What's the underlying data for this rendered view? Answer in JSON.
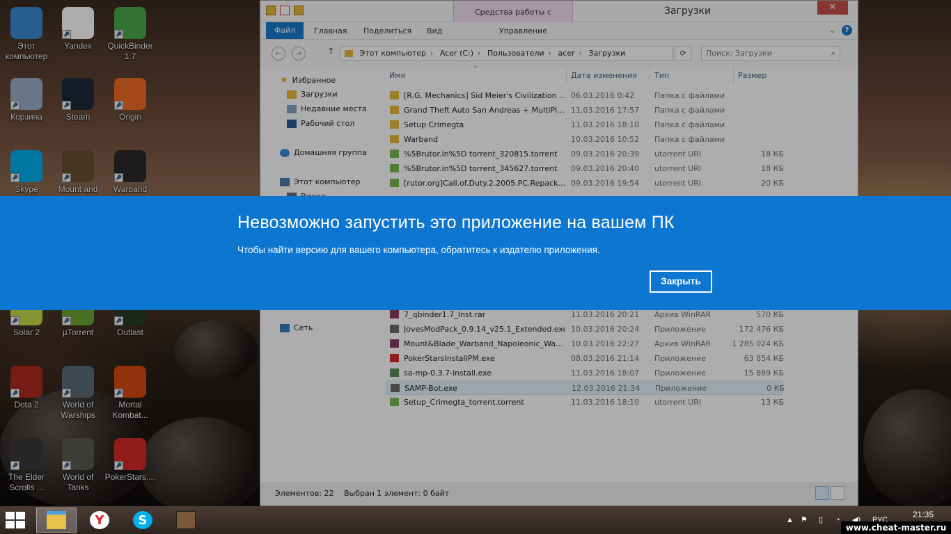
{
  "desktop": {
    "icons": [
      {
        "label": "Этот компьютер",
        "icon": "computer-icon",
        "color": "#3b8ad8"
      },
      {
        "label": "Yandex",
        "icon": "yandex-icon",
        "color": "#ffffff"
      },
      {
        "label": "QuickBinder 1.7",
        "icon": "quickbinder-icon",
        "color": "#4aa84a"
      },
      {
        "label": "Корзина",
        "icon": "recycle-bin-icon",
        "color": "#9ab0c8"
      },
      {
        "label": "Steam",
        "icon": "steam-icon",
        "color": "#1b2838"
      },
      {
        "label": "Origin",
        "icon": "origin-icon",
        "color": "#f06c22"
      },
      {
        "label": "Skype",
        "icon": "skype-icon",
        "color": "#00aff0"
      },
      {
        "label": "Mount and",
        "icon": "mount-and-blade-icon",
        "color": "#6b4e32"
      },
      {
        "label": "Warband",
        "icon": "warband-icon",
        "color": "#2a2a2a"
      },
      {
        "label": "Solar 2",
        "icon": "solar2-icon",
        "color": "#c8d84a"
      },
      {
        "label": "µTorrent",
        "icon": "utorrent-icon",
        "color": "#6aa832"
      },
      {
        "label": "Outlast",
        "icon": "outlast-icon",
        "color": "#2a3a2a"
      },
      {
        "label": "Dota 2",
        "icon": "dota2-icon",
        "color": "#b02a1e"
      },
      {
        "label": "World of Warships",
        "icon": "world-of-warships-icon",
        "color": "#5a6a78"
      },
      {
        "label": "Mortal Kombat...",
        "icon": "mortal-kombat-icon",
        "color": "#d84a12"
      },
      {
        "label": "The Elder Scrolls ...",
        "icon": "elder-scrolls-icon",
        "color": "#3a3a3a"
      },
      {
        "label": "World of Tanks",
        "icon": "world-of-tanks-icon",
        "color": "#5a5a52"
      },
      {
        "label": "PokerStars....",
        "icon": "pokerstars-icon",
        "color": "#d42a2a"
      }
    ]
  },
  "explorer": {
    "window_title": "Загрузки",
    "context_tab_group": "Средства работы с приложениями",
    "ribbon_tabs": {
      "file": "Файл",
      "home": "Главная",
      "share": "Поделиться",
      "view": "Вид",
      "manage": "Управление"
    },
    "close_glyph": "✕",
    "address_parts": [
      "Этот компьютер",
      "Acer (C:)",
      "Пользователи",
      "acer",
      "Загрузки"
    ],
    "search_placeholder": "Поиск: Загрузки",
    "nav_pane": {
      "favorites": "Избранное",
      "downloads": "Загрузки",
      "recent": "Недавние места",
      "desktop": "Рабочий стол",
      "homegroup": "Домашняя группа",
      "this_pc": "Этот компьютер",
      "videos": "Видео",
      "network": "Сеть"
    },
    "columns": {
      "name": "Имя",
      "date": "Дата изменения",
      "type": "Тип",
      "size": "Размер"
    },
    "files_top": [
      {
        "name": "[R.G. Mechanics] Sid Meier's Civilization ...",
        "date": "06.03.2016 0:42",
        "type": "Папка с файлами",
        "size": "",
        "icon": "folder-icon"
      },
      {
        "name": "Grand Theft Auto San Andreas + MultiPl...",
        "date": "11.03.2016 17:57",
        "type": "Папка с файлами",
        "size": "",
        "icon": "folder-icon"
      },
      {
        "name": "Setup Crimegta",
        "date": "11.03.2016 18:10",
        "type": "Папка с файлами",
        "size": "",
        "icon": "folder-icon"
      },
      {
        "name": "Warband",
        "date": "10.03.2016 10:52",
        "type": "Папка с файлами",
        "size": "",
        "icon": "folder-icon"
      },
      {
        "name": "%5Brutor.in%5D torrent_320815.torrent",
        "date": "09.03.2016 20:39",
        "type": "utorrent URI",
        "size": "18 КБ",
        "icon": "torrent-file-icon"
      },
      {
        "name": "%5Brutor.in%5D torrent_345627.torrent",
        "date": "09.03.2016 20:40",
        "type": "utorrent URI",
        "size": "18 КБ",
        "icon": "torrent-file-icon"
      },
      {
        "name": "[rutor.org]Call.of.Duty.2.2005.PC.Repack....",
        "date": "09.03.2016 19:54",
        "type": "utorrent URI",
        "size": "20 КБ",
        "icon": "torrent-file-icon"
      }
    ],
    "files_bottom": [
      {
        "name": "7_qbinder1.7_Inst.rar",
        "date": "11.03.2016 20:21",
        "type": "Архив WinRAR",
        "size": "570 КБ",
        "icon": "rar-icon",
        "selected": false
      },
      {
        "name": "JovesModPack_0.9.14_v25.1_Extended.exe",
        "date": "10.03.2016 20:24",
        "type": "Приложение",
        "size": "172 476 КБ",
        "icon": "exe-icon",
        "selected": false
      },
      {
        "name": "Mount&Blade_Warband_Napoleonic_Wa...",
        "date": "10.03.2016 22:27",
        "type": "Архив WinRAR",
        "size": "1 285 024 КБ",
        "icon": "rar-icon",
        "selected": false
      },
      {
        "name": "PokerStarsInstallPM.exe",
        "date": "08.03.2016 21:14",
        "type": "Приложение",
        "size": "63 854 КБ",
        "icon": "pokerstars-file-icon",
        "selected": false
      },
      {
        "name": "sa-mp-0.3.7-install.exe",
        "date": "11.03.2016 18:07",
        "type": "Приложение",
        "size": "15 889 КБ",
        "icon": "samp-icon",
        "selected": false
      },
      {
        "name": "SAMP-Bot.exe",
        "date": "12.03.2016 21:34",
        "type": "Приложение",
        "size": "0 КБ",
        "icon": "exe-icon",
        "selected": true
      },
      {
        "name": "Setup_Crimegta_torrent.torrent",
        "date": "11.03.2016 18:10",
        "type": "utorrent URI",
        "size": "13 КБ",
        "icon": "torrent-file-icon",
        "selected": false
      }
    ],
    "status": {
      "items": "Элементов: 22",
      "selected": "Выбран 1 элемент: 0 байт"
    }
  },
  "dialog": {
    "title": "Невозможно запустить это приложение на вашем ПК",
    "message": "Чтобы найти версию для вашего компьютера, обратитесь к издателю приложения.",
    "close_label": "Закрыть",
    "color": "#0c76d1"
  },
  "taskbar": {
    "apps": [
      {
        "icon": "file-explorer-icon",
        "active": true
      },
      {
        "icon": "yandex-browser-icon",
        "active": false
      },
      {
        "icon": "skype-icon",
        "active": false
      },
      {
        "icon": "gta-sa-icon",
        "active": false
      }
    ],
    "language": "РУС",
    "time": "21:35"
  },
  "watermark": "www.cheat-master.ru"
}
